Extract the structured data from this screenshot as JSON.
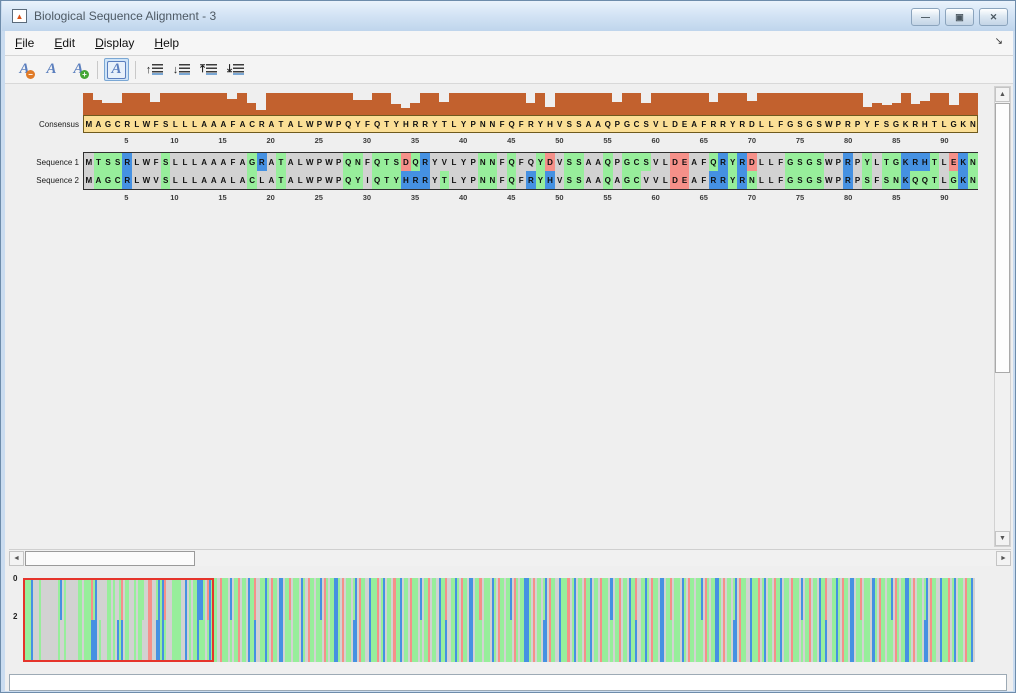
{
  "window": {
    "title": "Biological Sequence Alignment - 3",
    "controls": [
      {
        "name": "minimize",
        "glyph": "—"
      },
      {
        "name": "restore",
        "glyph": "▣"
      },
      {
        "name": "close",
        "glyph": "✕"
      }
    ]
  },
  "menubar": {
    "items": [
      "File",
      "Edit",
      "Display",
      "Help"
    ],
    "dock_arrow": "↘"
  },
  "toolbar": {
    "buttons": [
      {
        "name": "decrease-fontsize-button",
        "type": "font",
        "glyph": "A",
        "badge": "−",
        "badge_color": "#e07b28"
      },
      {
        "name": "reset-fontsize-button",
        "type": "font",
        "glyph": "A"
      },
      {
        "name": "increase-fontsize-button",
        "type": "font",
        "glyph": "A",
        "badge": "+",
        "badge_color": "#44a636"
      },
      {
        "type": "separator"
      },
      {
        "name": "toggle-legends-button",
        "type": "font",
        "glyph": "A",
        "boxed": true,
        "pressed": true
      },
      {
        "type": "separator"
      },
      {
        "name": "move-sequence-up-button",
        "type": "move",
        "arrow": "↑"
      },
      {
        "name": "move-sequence-down-button",
        "type": "move",
        "arrow": "↓"
      },
      {
        "name": "move-sequence-to-top-button",
        "type": "move",
        "arrow": "⤒"
      },
      {
        "name": "move-sequence-to-bottom-button",
        "type": "move",
        "arrow": "⤓"
      }
    ]
  },
  "alignment": {
    "length": 93,
    "ruler_interval": 5,
    "consensus_label": "Consensus",
    "consensus": "MAGCRLWFSLLLAAAFACRATALWPWPQYFQTYHRRYTLYPNNFQFRYHVSSAAQPGCSVLDEAFRRYRDLLFGSGSWPRPYFSGKRHTLGKN",
    "conservation": [
      1,
      0.7,
      0.55,
      0.55,
      1,
      1,
      1,
      0.6,
      1,
      1,
      1,
      1,
      1,
      1,
      1,
      0.75,
      1,
      0.55,
      0.25,
      1,
      1,
      1,
      1,
      1,
      1,
      1,
      1,
      1,
      0.7,
      0.7,
      1,
      1,
      0.5,
      0.3,
      0.55,
      1,
      1,
      0.6,
      1,
      1,
      1,
      1,
      1,
      1,
      1,
      1,
      0.55,
      1,
      0.35,
      1,
      1,
      1,
      1,
      1,
      1,
      0.6,
      1,
      1,
      0.55,
      1,
      1,
      1,
      1,
      1,
      1,
      0.6,
      1,
      1,
      1,
      0.65,
      1,
      1,
      1,
      1,
      1,
      1,
      1,
      1,
      1,
      1,
      1,
      0.35,
      0.55,
      0.45,
      0.55,
      1,
      0.5,
      0.65,
      1,
      1,
      0.45,
      1,
      1
    ],
    "sequences": [
      {
        "label": "Sequence 1",
        "residues": "MTSSRLWFSLLLAAAFAGRATALWPWPQNFQTSDQRYVLYPNNFQFQYDVSSAAQPGCSVLDEAFQRYRDLLFGSGSWPRPYLTGKRHTLEKN",
        "colors": "xgggbxxxgxxxxxxxxgbxgxxxxxxggxgggrgbxxxxxggxgxxgrxggxxgxgggxxrrxxgbgbrxxxggggxxbxgxggbbbgxrbg"
      },
      {
        "label": "Sequence 2",
        "residues": "MAGCRLWVSLLLAAALACLATALWPWPQYIQTYHRRYTLYPNNFQFRYHVSSAAQAGCVVLDEAFRRYRNLLFGSGSWPRPSFSNKQQTLGKN",
        "colors": "xgggbxxxgxxxxxxxxgxxgxxxxxxggxgggbbbxgxxxggxgxbgbxggxxgxggxxxrrxxbbgbgxxxggggxxbxgxggbgggxgbg"
      }
    ],
    "color_map": {
      "g": "#97ee9b",
      "b": "#4591e2",
      "r": "#f59089",
      "x": "#d2d2d2"
    },
    "histogram_color": "#c2612e",
    "consensus_bg": "#fbdf96"
  },
  "overview": {
    "y_labels": [
      "0",
      "2"
    ],
    "viewport_fraction": 0.2,
    "tail_top": "ggxrgggxbxggrxggxbggrxxggbgxrggxbbxggrxgggxbgxrggxggbxrgxggbbgxrxggxgbxrggxxbgggrxgbxggxrggbx",
    "tail_bottom": "ggxrgggxgxggrxggxbggbxxggbgxrggxbbxgggxgggxbgxrggxgggxrgxggbbgxrxggxbbxrggxxbgggrxgbxggxrggbx",
    "tail_repeats": 4
  },
  "statusbar": {
    "value": ""
  }
}
